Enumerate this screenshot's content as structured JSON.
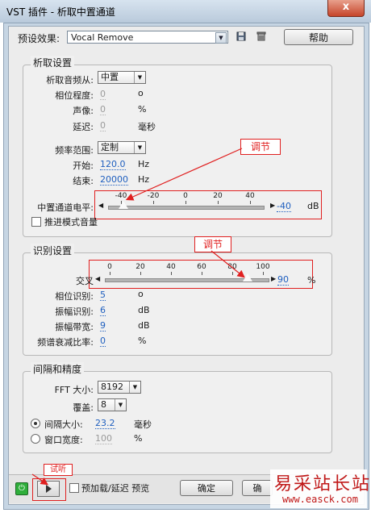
{
  "window": {
    "title": "VST 插件 - 析取中置通道",
    "close_label": "x"
  },
  "preset": {
    "label": "预设效果:",
    "value": "Vocal Remove",
    "help_label": "帮助"
  },
  "extract": {
    "title": "析取设置",
    "freq_from_label": "析取音频从:",
    "freq_from_value": "中置",
    "phase_label": "相位程度:",
    "phase_value": "0",
    "phase_unit": "o",
    "pan_label": "声像:",
    "pan_value": "0",
    "pan_unit": "%",
    "delay_label": "延迟:",
    "delay_value": "0",
    "delay_unit": "毫秒",
    "range_label": "频率范围:",
    "range_value": "定制",
    "start_label": "开始:",
    "start_value": "120.0",
    "start_unit": "Hz",
    "end_label": "结束:",
    "end_value": "20000",
    "end_unit": "Hz",
    "level_label": "中置通道电平:",
    "level_ticks": [
      "-40",
      "-20",
      "0",
      "20",
      "40"
    ],
    "level_value": "-40",
    "level_unit": "dB",
    "level_fraction": 0.0,
    "boost_label": "推进模式音量"
  },
  "recognize": {
    "title": "识别设置",
    "cross_label": "交叉",
    "cross_ticks": [
      "0",
      "20",
      "40",
      "60",
      "80",
      "100"
    ],
    "cross_value": "90",
    "cross_unit": "%",
    "cross_fraction": 0.9,
    "phase_label": "相位识别:",
    "phase_value": "5",
    "phase_unit": "o",
    "amp_label": "振幅识别:",
    "amp_value": "6",
    "amp_unit": "dB",
    "amp_bw_label": "振幅带宽:",
    "amp_bw_value": "9",
    "amp_bw_unit": "dB",
    "spec_label": "频谱衰减比率:",
    "spec_value": "0",
    "spec_unit": "%"
  },
  "interval": {
    "title": "间隔和精度",
    "fft_label": "FFT 大小:",
    "fft_value": "8192",
    "overlap_label": "覆盖:",
    "overlap_value": "8",
    "interval_label": "间隔大小:",
    "interval_value": "23.2",
    "interval_unit": "毫秒",
    "winwidth_label": "窗口宽度:",
    "winwidth_value": "100",
    "winwidth_unit": "%"
  },
  "bottom": {
    "preload_label": "预加载/延迟 预览",
    "ok_label": "确定",
    "cancel_label": "确"
  },
  "annotations": {
    "callout1": "调节",
    "callout2": "调节",
    "callout3": "试听"
  },
  "watermark": {
    "brand": "易采站长站",
    "url": "www.easck.com"
  },
  "colors": {
    "accent_blue": "#1f5fbf",
    "annotation_red": "#e02020",
    "power_green": "#2fae3b"
  }
}
